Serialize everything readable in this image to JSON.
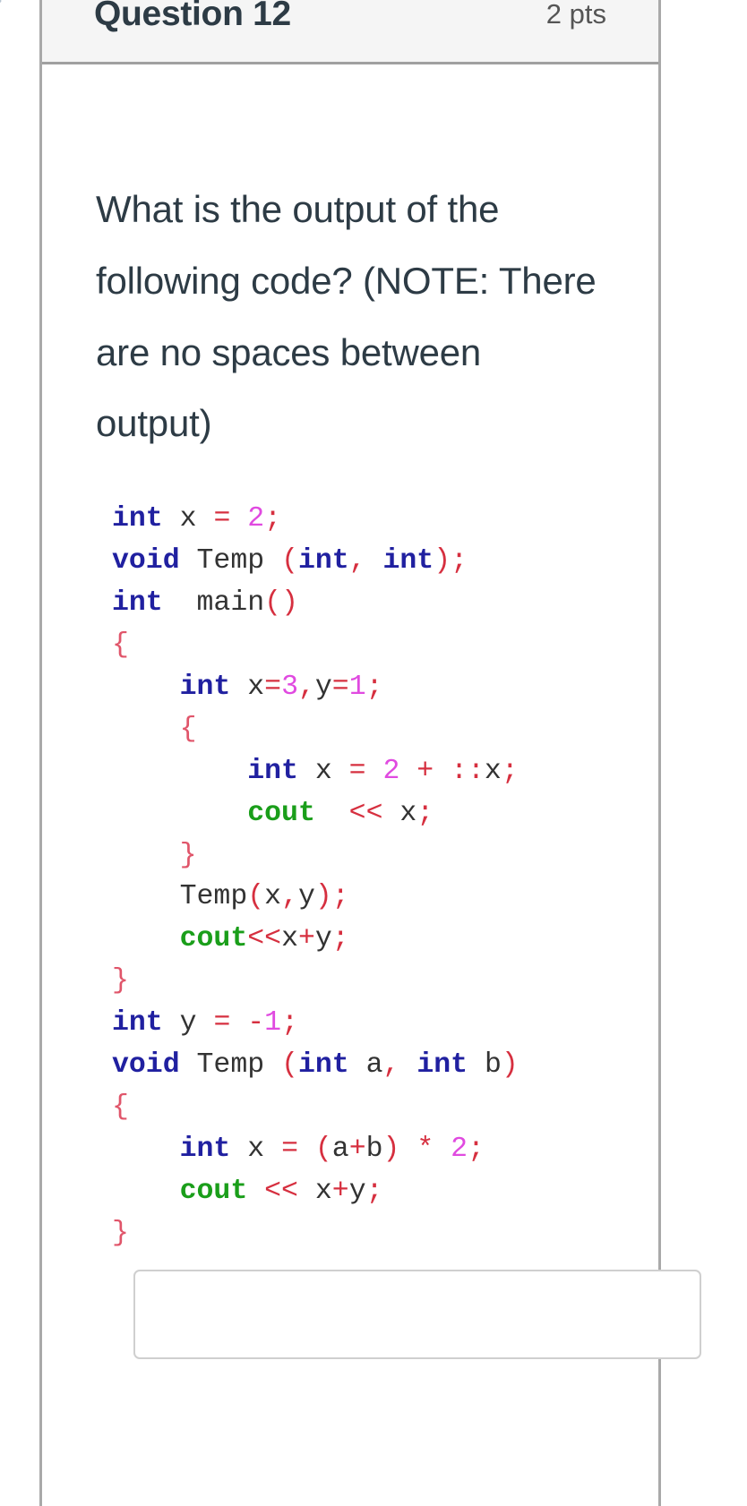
{
  "corner": {
    "glyph": "›"
  },
  "header": {
    "question_name": "Question 12",
    "points": "2 pts"
  },
  "question": {
    "text": "What is the output of the following code? (NOTE: There are no spaces between output)"
  },
  "code": {
    "language": "cpp",
    "plain_text": "int x = 2;\nvoid Temp (int, int);\nint  main()\n{\n    int x=3,y=1;\n    {\n        int x = 2 + ::x;\n        cout  << x;\n    }\n    Temp(x,y);\n    cout<<x+y;\n}\nint y = -1;\nvoid Temp (int a, int b)\n{\n    int x = (a+b) * 2;\n    cout << x+y;\n}",
    "lines": [
      [
        {
          "t": "int",
          "c": "kw"
        },
        {
          "t": " ",
          "c": "id"
        },
        {
          "t": "x",
          "c": "id"
        },
        {
          "t": " ",
          "c": "id"
        },
        {
          "t": "=",
          "c": "op"
        },
        {
          "t": " ",
          "c": "id"
        },
        {
          "t": "2",
          "c": "num"
        },
        {
          "t": ";",
          "c": "pun"
        }
      ],
      [
        {
          "t": "void",
          "c": "kw"
        },
        {
          "t": " ",
          "c": "id"
        },
        {
          "t": "Temp",
          "c": "id"
        },
        {
          "t": " ",
          "c": "id"
        },
        {
          "t": "(",
          "c": "pun"
        },
        {
          "t": "int",
          "c": "kw"
        },
        {
          "t": ",",
          "c": "pun"
        },
        {
          "t": " ",
          "c": "id"
        },
        {
          "t": "int",
          "c": "kw"
        },
        {
          "t": ")",
          "c": "pun"
        },
        {
          "t": ";",
          "c": "pun"
        }
      ],
      [
        {
          "t": "int",
          "c": "kw"
        },
        {
          "t": "  ",
          "c": "id"
        },
        {
          "t": "main",
          "c": "id"
        },
        {
          "t": "(",
          "c": "pun"
        },
        {
          "t": ")",
          "c": "pun"
        }
      ],
      [
        {
          "t": "{",
          "c": "brc"
        }
      ],
      [
        {
          "t": "    ",
          "c": "id"
        },
        {
          "t": "int",
          "c": "kw"
        },
        {
          "t": " ",
          "c": "id"
        },
        {
          "t": "x",
          "c": "id"
        },
        {
          "t": "=",
          "c": "op"
        },
        {
          "t": "3",
          "c": "num"
        },
        {
          "t": ",",
          "c": "pun"
        },
        {
          "t": "y",
          "c": "id"
        },
        {
          "t": "=",
          "c": "op"
        },
        {
          "t": "1",
          "c": "num"
        },
        {
          "t": ";",
          "c": "pun"
        }
      ],
      [
        {
          "t": "    ",
          "c": "id"
        },
        {
          "t": "{",
          "c": "brc"
        }
      ],
      [
        {
          "t": "        ",
          "c": "id"
        },
        {
          "t": "int",
          "c": "kw"
        },
        {
          "t": " ",
          "c": "id"
        },
        {
          "t": "x",
          "c": "id"
        },
        {
          "t": " ",
          "c": "id"
        },
        {
          "t": "=",
          "c": "op"
        },
        {
          "t": " ",
          "c": "id"
        },
        {
          "t": "2",
          "c": "num"
        },
        {
          "t": " ",
          "c": "id"
        },
        {
          "t": "+",
          "c": "op"
        },
        {
          "t": " ",
          "c": "id"
        },
        {
          "t": "::",
          "c": "pun"
        },
        {
          "t": "x",
          "c": "id"
        },
        {
          "t": ";",
          "c": "pun"
        }
      ],
      [
        {
          "t": "        ",
          "c": "id"
        },
        {
          "t": "cout",
          "c": "out"
        },
        {
          "t": "  ",
          "c": "id"
        },
        {
          "t": "<<",
          "c": "op"
        },
        {
          "t": " ",
          "c": "id"
        },
        {
          "t": "x",
          "c": "id"
        },
        {
          "t": ";",
          "c": "pun"
        }
      ],
      [
        {
          "t": "    ",
          "c": "id"
        },
        {
          "t": "}",
          "c": "brc"
        }
      ],
      [
        {
          "t": "    ",
          "c": "id"
        },
        {
          "t": "Temp",
          "c": "id"
        },
        {
          "t": "(",
          "c": "pun"
        },
        {
          "t": "x",
          "c": "id"
        },
        {
          "t": ",",
          "c": "pun"
        },
        {
          "t": "y",
          "c": "id"
        },
        {
          "t": ")",
          "c": "pun"
        },
        {
          "t": ";",
          "c": "pun"
        }
      ],
      [
        {
          "t": "    ",
          "c": "id"
        },
        {
          "t": "cout",
          "c": "out"
        },
        {
          "t": "<<",
          "c": "op"
        },
        {
          "t": "x",
          "c": "id"
        },
        {
          "t": "+",
          "c": "op"
        },
        {
          "t": "y",
          "c": "id"
        },
        {
          "t": ";",
          "c": "pun"
        }
      ],
      [
        {
          "t": "}",
          "c": "brc"
        }
      ],
      [
        {
          "t": "int",
          "c": "kw"
        },
        {
          "t": " ",
          "c": "id"
        },
        {
          "t": "y",
          "c": "id"
        },
        {
          "t": " ",
          "c": "id"
        },
        {
          "t": "=",
          "c": "op"
        },
        {
          "t": " ",
          "c": "id"
        },
        {
          "t": "-",
          "c": "op"
        },
        {
          "t": "1",
          "c": "num"
        },
        {
          "t": ";",
          "c": "pun"
        }
      ],
      [
        {
          "t": "void",
          "c": "kw"
        },
        {
          "t": " ",
          "c": "id"
        },
        {
          "t": "Temp",
          "c": "id"
        },
        {
          "t": " ",
          "c": "id"
        },
        {
          "t": "(",
          "c": "pun"
        },
        {
          "t": "int",
          "c": "kw"
        },
        {
          "t": " ",
          "c": "id"
        },
        {
          "t": "a",
          "c": "id"
        },
        {
          "t": ",",
          "c": "pun"
        },
        {
          "t": " ",
          "c": "id"
        },
        {
          "t": "int",
          "c": "kw"
        },
        {
          "t": " ",
          "c": "id"
        },
        {
          "t": "b",
          "c": "id"
        },
        {
          "t": ")",
          "c": "pun"
        }
      ],
      [
        {
          "t": "{",
          "c": "brc"
        }
      ],
      [
        {
          "t": "    ",
          "c": "id"
        },
        {
          "t": "int",
          "c": "kw"
        },
        {
          "t": " ",
          "c": "id"
        },
        {
          "t": "x",
          "c": "id"
        },
        {
          "t": " ",
          "c": "id"
        },
        {
          "t": "=",
          "c": "op"
        },
        {
          "t": " ",
          "c": "id"
        },
        {
          "t": "(",
          "c": "pun"
        },
        {
          "t": "a",
          "c": "id"
        },
        {
          "t": "+",
          "c": "op"
        },
        {
          "t": "b",
          "c": "id"
        },
        {
          "t": ")",
          "c": "pun"
        },
        {
          "t": " ",
          "c": "id"
        },
        {
          "t": "*",
          "c": "op"
        },
        {
          "t": " ",
          "c": "id"
        },
        {
          "t": "2",
          "c": "num"
        },
        {
          "t": ";",
          "c": "pun"
        }
      ],
      [
        {
          "t": "    ",
          "c": "id"
        },
        {
          "t": "cout",
          "c": "out"
        },
        {
          "t": " ",
          "c": "id"
        },
        {
          "t": "<<",
          "c": "op"
        },
        {
          "t": " ",
          "c": "id"
        },
        {
          "t": "x",
          "c": "id"
        },
        {
          "t": "+",
          "c": "op"
        },
        {
          "t": "y",
          "c": "id"
        },
        {
          "t": ";",
          "c": "pun"
        }
      ],
      [
        {
          "t": "}",
          "c": "brc"
        }
      ]
    ]
  },
  "answer": {
    "value": "",
    "placeholder": ""
  },
  "colors": {
    "header_bg": "#f5f5f5",
    "title_text": "#2d3b45",
    "points_text": "#555555",
    "card_border": "#a9a9a9",
    "input_border": "#cfcfcf",
    "keyword": "#2020a0",
    "cout": "#1a9e1a",
    "number": "#e04ae0",
    "operator": "#d62f3f",
    "brace": "#e0556a",
    "identifier": "#333333"
  }
}
